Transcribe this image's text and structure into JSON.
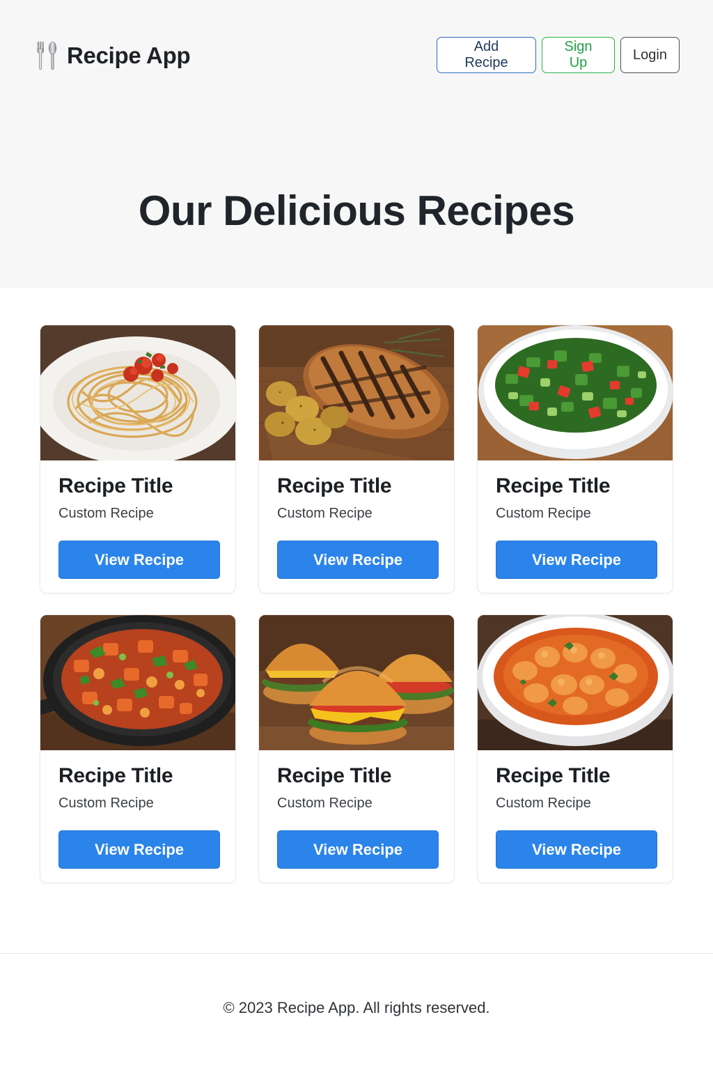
{
  "app": {
    "name": "Recipe App",
    "logo_icon": "fork-and-spoon-icon"
  },
  "nav": {
    "add_recipe": "Add Recipe",
    "sign_up": "Sign Up",
    "login": "Login"
  },
  "hero": {
    "title": "Our Delicious Recipes"
  },
  "recipes": [
    {
      "title": "Recipe Title",
      "subtitle": "Custom Recipe",
      "button": "View Recipe",
      "image": "spaghetti-image"
    },
    {
      "title": "Recipe Title",
      "subtitle": "Custom Recipe",
      "button": "View Recipe",
      "image": "grilled-chicken-image"
    },
    {
      "title": "Recipe Title",
      "subtitle": "Custom Recipe",
      "button": "View Recipe",
      "image": "salad-image"
    },
    {
      "title": "Recipe Title",
      "subtitle": "Custom Recipe",
      "button": "View Recipe",
      "image": "vegetable-stew-image"
    },
    {
      "title": "Recipe Title",
      "subtitle": "Custom Recipe",
      "button": "View Recipe",
      "image": "burgers-image"
    },
    {
      "title": "Recipe Title",
      "subtitle": "Custom Recipe",
      "button": "View Recipe",
      "image": "curry-image"
    }
  ],
  "footer": {
    "text": "© 2023 Recipe App. All rights reserved."
  },
  "colors": {
    "primary": "#2b84ea",
    "success": "#22b24a",
    "header_bg": "#f7f7f7"
  }
}
